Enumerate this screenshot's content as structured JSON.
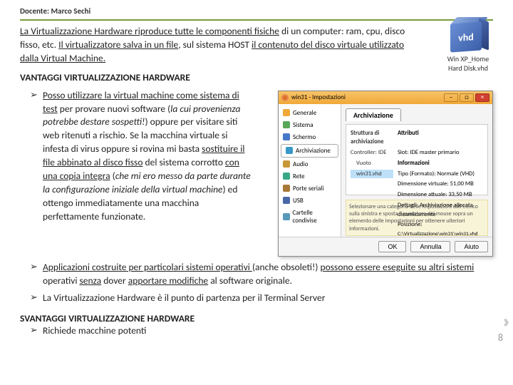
{
  "header": {
    "docente": "Docente: Marco Sechi"
  },
  "intro": {
    "p1a": "La Virtualizzazione Hardware riproduce tutte le componenti fisiche",
    "p1b": " di un computer: ram, cpu, disco fisso, etc. ",
    "p1c": "Il virtualizzatore salva in un file",
    "p1d": ", sul sistema HOST ",
    "p1e": "il contenuto del disco virtuale utilizzato dalla Virtual Machine.",
    "vantaggi": "VANTAGGI VIRTUALIZZAZIONE HARDWARE"
  },
  "bullets": {
    "b1a": "Posso utilizzare la virtual machine come sistema di test",
    "b1b": " per provare nuovi software (",
    "b1c": "la cui provenienza potrebbe destare sospetti!",
    "b1d": ") oppure per visitare siti web ritenuti a rischio. Se la macchina virtuale si infesta di virus oppure si rovina mi basta ",
    "b1e": "sostituire il file abbinato al disco fisso",
    "b1f": " del sistema corrotto ",
    "b1g": "con una copia integra",
    "b1h": " (",
    "b1i": "che mi ero messo da parte durante la configurazione iniziale della virtual machine",
    "b1j": ") ed ottengo immediatamente una macchina perfettamente funzionate.",
    "b2a": "Applicazioni costruite per particolari sistemi operativi ",
    "b2b": "(anche obsoleti!) ",
    "b2c": "possono essere eseguite su altri sistemi",
    "b2d": " operativi ",
    "b2e": "senza",
    "b2f": " dover ",
    "b2g": "apportare modifiche",
    "b2h": " al software originale.",
    "b3": "La Virtualizzazione Hardware è il punto di partenza per il Terminal Server",
    "svantaggi": "SVANTAGGI VIRTUALIZZAZIONE HARDWARE",
    "s1": "Richiede macchine potenti"
  },
  "vhd": {
    "label": "vhd",
    "caption1": "Win XP_Home",
    "caption2": "Hard Disk.vhd"
  },
  "vbox": {
    "title": "win31 - Impostazioni",
    "close": "×",
    "min": "–",
    "max": "□",
    "side": {
      "generale": "Generale",
      "sistema": "Sistema",
      "schermo": "Schermo",
      "archiviazione": "Archiviazione",
      "audio": "Audio",
      "rete": "Rete",
      "porte": "Porte seriali",
      "usb": "USB",
      "cartelle": "Cartelle condivise"
    },
    "main": {
      "tab": "Archiviazione",
      "tree_title": "Struttura di archiviazione",
      "attr_title": "Attributi",
      "ctrl_ide": "Controller: IDE",
      "vuoto": "Vuoto",
      "disk": "win31.vhd",
      "slot_lbl": "Slot:",
      "slot_val": "IDE master primario",
      "info_lbl": "Informazioni",
      "tipo_lbl": "Tipo (Formato):",
      "tipo_val": "Normale (VHD)",
      "dim_lbl": "Dimensione virtuale:",
      "dim_val": "51,00 MB",
      "dim2_lbl": "Dimensione attuale:",
      "dim2_val": "33,50 MB",
      "det_lbl": "Dettagli:",
      "det_val": "Archiviazione allocata dinamicamente",
      "pos_lbl": "Posizione:",
      "pos_val": "C:\\Virtualizzazione\\win31\\win31.vhd",
      "desc": "Selezionare una categoria delle impostazioni dall'elenco sulla sinistra e sposta il puntatore del mouse sopra un elemento delle impostazioni per ottenere ulteriori informazioni."
    },
    "footer": {
      "ok": "OK",
      "annulla": "Annulla",
      "aiuto": "Aiuto"
    }
  },
  "pagenum": "8"
}
